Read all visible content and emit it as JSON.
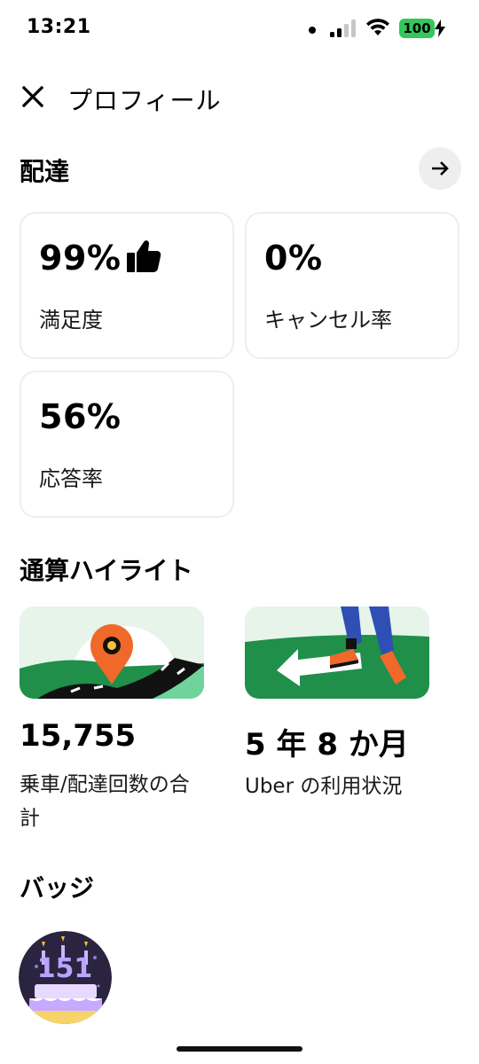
{
  "status": {
    "time": "13:21",
    "battery": "100"
  },
  "header": {
    "title": "プロフィール",
    "close_icon": "close-icon"
  },
  "delivery": {
    "title": "配達",
    "arrow_icon": "arrow-right-icon",
    "stats": [
      {
        "value": "99%",
        "label": "満足度",
        "icon": "thumbs-up-icon"
      },
      {
        "value": "0%",
        "label": "キャンセル率"
      },
      {
        "value": "56%",
        "label": "応答率"
      }
    ]
  },
  "highlights": {
    "title": "通算ハイライト",
    "items": [
      {
        "value": "15,755",
        "label_line1": "乗車/配達回数の合",
        "label_line2": "計",
        "image": "map-pin-road-illustration"
      },
      {
        "value": "5 年 8 か月",
        "label_line1": "Uber の利用状況",
        "image": "walking-arrow-illustration"
      }
    ]
  },
  "badges": {
    "title": "バッジ",
    "items": [
      {
        "image": "birthday-cake-badge"
      }
    ]
  },
  "colors": {
    "green": "#1a9e4b",
    "accent_orange": "#f0692a",
    "card_border": "#eeeeee",
    "badge_bg": "#2b2440"
  }
}
